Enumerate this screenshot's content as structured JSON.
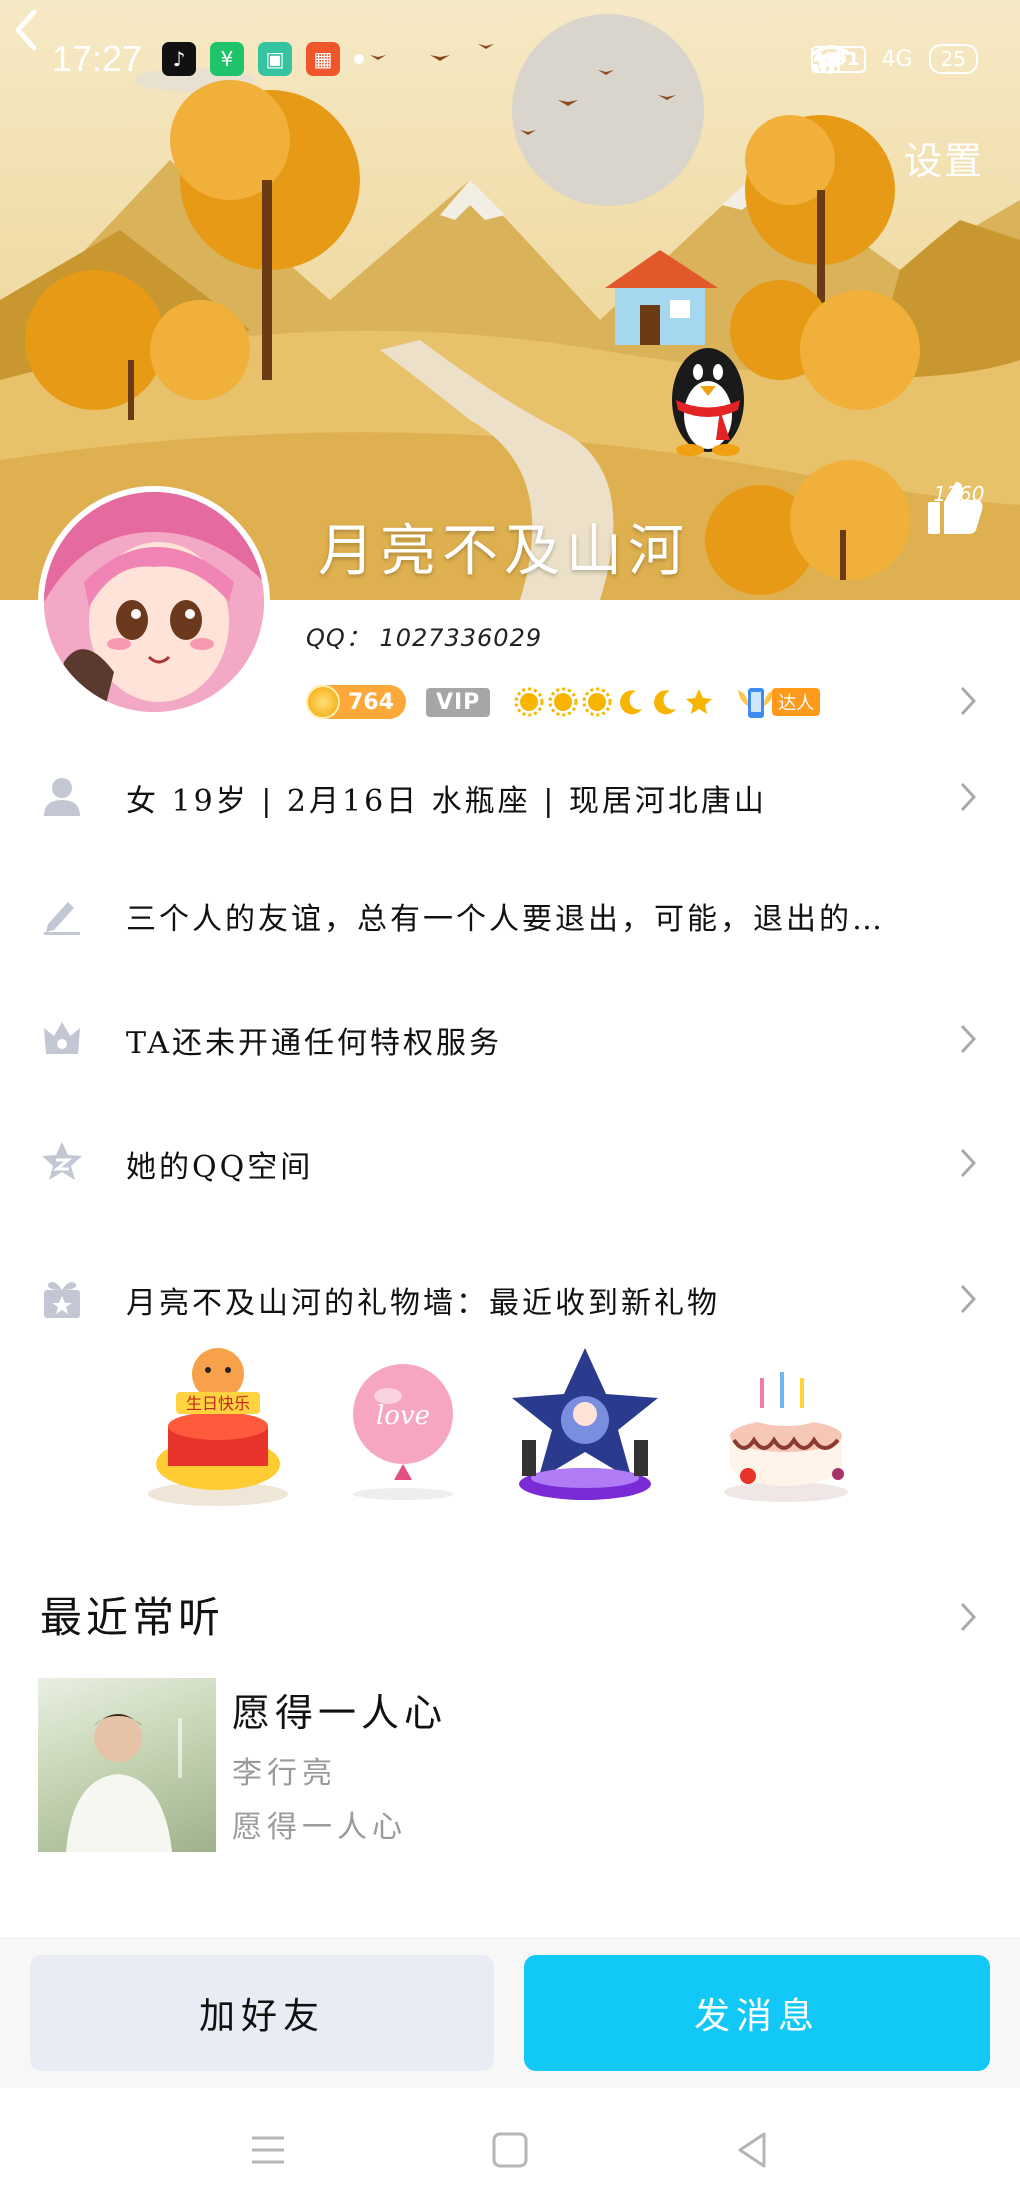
{
  "status_bar": {
    "time": "17:27",
    "hd_label": "HD1",
    "network_label": "4G",
    "battery_level": "25"
  },
  "header": {
    "settings_label": "设置",
    "nickname": "月亮不及山河",
    "like_count": "1260"
  },
  "profile": {
    "qq_label": "QQ：",
    "qq_number": "1027336029",
    "coin_value": "764",
    "vip_label": "VIP",
    "talent_label": "达人"
  },
  "rows": {
    "basic_info": "女  19岁 | 2月16日  水瓶座 | 现居河北唐山",
    "signature": "三个人的友谊，总有一个人要退出，可能，退出的…",
    "privilege": "TA还未开通任何特权服务",
    "qzone": "她的QQ空间",
    "gift_wall": "月亮不及山河的礼物墙：最近收到新礼物"
  },
  "gifts": {
    "gift_1_text": "生日快乐",
    "gift_2_text": "love"
  },
  "recent": {
    "title": "最近常听",
    "song_title": "愿得一人心",
    "artist": "李行亮",
    "album": "愿得一人心"
  },
  "actions": {
    "add_friend": "加好友",
    "send_message": "发消息"
  },
  "colors": {
    "accent": "#12c8f7",
    "add_friend_bg": "#e9ebf5",
    "banner_sky": "#f2e2b4",
    "coin": "#ffa83a",
    "vip_gray": "#a6a6a6"
  }
}
